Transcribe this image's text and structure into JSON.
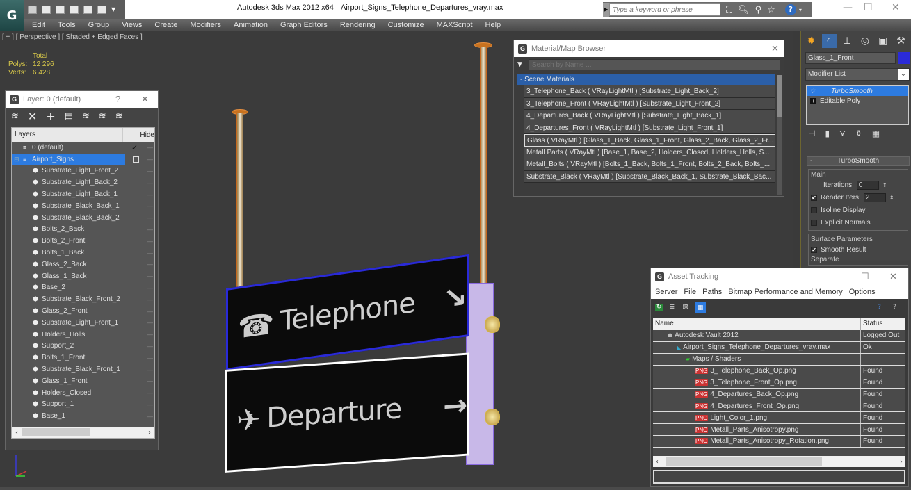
{
  "app": {
    "title": "Autodesk 3ds Max  2012 x64",
    "file": "Airport_Signs_Telephone_Departures_vray.max",
    "logo": "3ds-max-logo",
    "quick_access_icons": [
      "open-icon",
      "save-icon",
      "new-icon",
      "project-icon",
      "window-icon",
      "window2-icon"
    ],
    "search_placeholder": "Type a keyword or phrase",
    "infocenter_icons": [
      "binoculars-icon",
      "key-icon",
      "satellite-icon",
      "star-icon"
    ],
    "help": "?"
  },
  "menu": [
    "Edit",
    "Tools",
    "Group",
    "Views",
    "Create",
    "Modifiers",
    "Animation",
    "Graph Editors",
    "Rendering",
    "Customize",
    "MAXScript",
    "Help"
  ],
  "viewport": {
    "label": "[ + ] [ Perspective ] [ Shaded + Edged Faces ]",
    "stats_header": "Total",
    "polys_label": "Polys:",
    "polys": "12 296",
    "verts_label": "Verts:",
    "verts": "6 428",
    "sign_top_text": "Telephone",
    "sign_bottom_text": "Departure"
  },
  "layer_dialog": {
    "title": "Layer: 0 (default)",
    "help": "?",
    "columns": {
      "name": "Layers",
      "hide": "Hide"
    },
    "layers": [
      {
        "name": "0 (default)",
        "type": "layer",
        "check": "✓"
      },
      {
        "name": "Airport_Signs",
        "type": "layer",
        "selected": true
      }
    ],
    "objects": [
      "Substrate_Light_Front_2",
      "Substrate_Light_Back_2",
      "Substrate_Light_Back_1",
      "Substrate_Black_Back_1",
      "Substrate_Black_Back_2",
      "Bolts_2_Back",
      "Bolts_2_Front",
      "Bolts_1_Back",
      "Glass_2_Back",
      "Glass_1_Back",
      "Base_2",
      "Substrate_Black_Front_2",
      "Glass_2_Front",
      "Substrate_Light_Front_1",
      "Holders_Holls",
      "Support_2",
      "Bolts_1_Front",
      "Substrate_Black_Front_1",
      "Glass_1_Front",
      "Holders_Closed",
      "Support_1",
      "Base_1"
    ]
  },
  "material_browser": {
    "title": "Material/Map Browser",
    "search_placeholder": "Search by Name ...",
    "group": "- Scene Materials",
    "materials": [
      "3_Telephone_Back  ( VRayLightMtl ) [Substrate_Light_Back_2]",
      "3_Telephone_Front  ( VRayLightMtl ) [Substrate_Light_Front_2]",
      "4_Departures_Back  ( VRayLightMtl ) [Substrate_Light_Back_1]",
      "4_Departures_Front  ( VRayLightMtl ) [Substrate_Light_Front_1]",
      "Glass  ( VRayMtl ) [Glass_1_Back, Glass_1_Front, Glass_2_Back, Glass_2_Fr...",
      "Metall Parts  ( VRayMtl ) [Base_1, Base_2, Holders_Closed, Holders_Holls, S...",
      "Metall_Bolts  ( VRayMtl ) [Bolts_1_Back, Bolts_1_Front, Bolts_2_Back, Bolts_...",
      "Substrate_Black  ( VRayMtl ) [Substrate_Black_Back_1, Substrate_Black_Bac..."
    ],
    "focused_index": 4
  },
  "command_panel": {
    "object_name": "Glass_1_Front",
    "object_color": "#2b2bd8",
    "modifier_list": "Modifier List",
    "stack": [
      {
        "name": "TurboSmooth",
        "selected": true
      },
      {
        "name": "Editable Poly",
        "selected": false
      }
    ],
    "rollout": {
      "title": "TurboSmooth",
      "main_label": "Main",
      "iterations_label": "Iterations:",
      "iterations": "0",
      "render_iters_label": "Render Iters:",
      "render_iters": "2",
      "render_iters_checked": true,
      "isoline_label": "Isoline Display",
      "isoline_checked": false,
      "explicit_label": "Explicit Normals",
      "explicit_checked": false,
      "surface_label": "Surface Parameters",
      "smooth_result_label": "Smooth Result",
      "smooth_result_checked": true,
      "separate_label": "Separate"
    }
  },
  "asset_tracking": {
    "title": "Asset Tracking",
    "menu": [
      "Server",
      "File",
      "Paths",
      "Bitmap Performance and Memory",
      "Options"
    ],
    "columns": {
      "name": "Name",
      "status": "Status"
    },
    "rows": [
      {
        "name": "Autodesk Vault 2012",
        "status": "Logged Out",
        "indent": 1,
        "icon": "vault-icon"
      },
      {
        "name": "Airport_Signs_Telephone_Departures_vray.max",
        "status": "Ok",
        "indent": 2,
        "icon": "max-file-icon"
      },
      {
        "name": "Maps / Shaders",
        "status": "",
        "indent": 3,
        "icon": "maps-icon"
      },
      {
        "name": "3_Telephone_Back_Op.png",
        "status": "Found",
        "indent": 4,
        "icon": "png-icon"
      },
      {
        "name": "3_Telephone_Front_Op.png",
        "status": "Found",
        "indent": 4,
        "icon": "png-icon"
      },
      {
        "name": "4_Departures_Back_Op.png",
        "status": "Found",
        "indent": 4,
        "icon": "png-icon"
      },
      {
        "name": "4_Departures_Front_Op.png",
        "status": "Found",
        "indent": 4,
        "icon": "png-icon"
      },
      {
        "name": "Light_Color_1.png",
        "status": "Found",
        "indent": 4,
        "icon": "png-icon"
      },
      {
        "name": "Metall_Parts_Anisotropy.png",
        "status": "Found",
        "indent": 4,
        "icon": "png-icon"
      },
      {
        "name": "Metall_Parts_Anisotropy_Rotation.png",
        "status": "Found",
        "indent": 4,
        "icon": "png-icon"
      }
    ],
    "path_value": ""
  }
}
